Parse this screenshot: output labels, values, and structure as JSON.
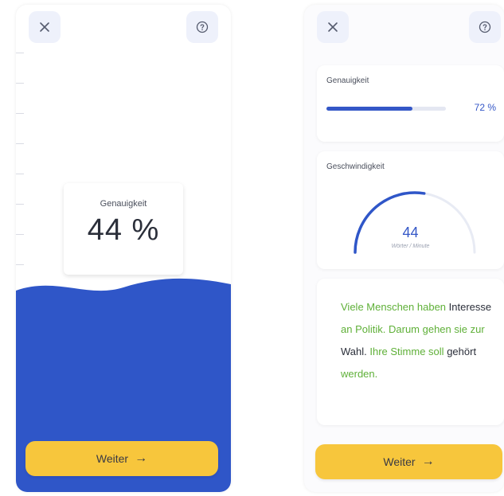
{
  "colors": {
    "accent_blue": "#2f56c8",
    "cta_yellow": "#f7c63c",
    "correct_green": "#5fb038",
    "icon_bg": "#eef1fb"
  },
  "icons": {
    "close": "close-icon",
    "help": "help-circle-icon",
    "arrow": "arrow-right-icon"
  },
  "left": {
    "accuracy_label": "Genauigkeit",
    "accuracy_value": "44 %",
    "accuracy_fraction": 0.44,
    "cta_label": "Weiter",
    "cta_arrow": "→"
  },
  "right": {
    "accuracy": {
      "label": "Genauigkeit",
      "percent_text": "72 %",
      "fraction": 0.72
    },
    "speed": {
      "label": "Geschwindigkeit",
      "value": "44",
      "unit": "Wörter / Minute",
      "gauge_fraction": 0.55
    },
    "story": [
      {
        "text": "Viele Menschen haben",
        "correct": true
      },
      {
        "text": "Interesse",
        "correct": false
      },
      {
        "text": "an Politik.",
        "correct": true
      },
      {
        "text": "Darum gehen sie zur",
        "correct": true
      },
      {
        "text": "Wahl.",
        "correct": false
      },
      {
        "text": "Ihre Stimme soll",
        "correct": true
      },
      {
        "text": "gehört",
        "correct": false
      },
      {
        "text": "werden.",
        "correct": true
      }
    ],
    "cta_label": "Weiter",
    "cta_arrow": "→"
  }
}
